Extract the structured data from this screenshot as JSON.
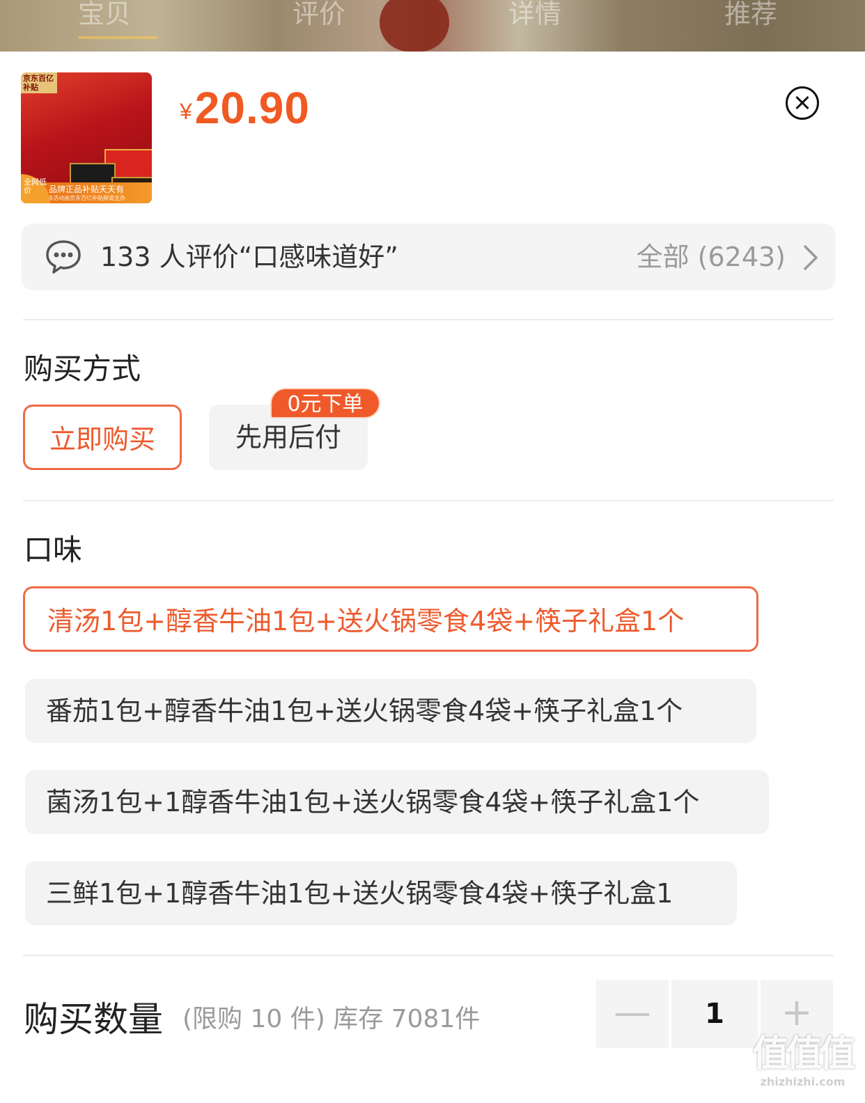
{
  "top_tabs": [
    {
      "label": "宝贝"
    },
    {
      "label": "评价"
    },
    {
      "label": "详情"
    },
    {
      "label": "推荐"
    }
  ],
  "product": {
    "thumb_tag": "京东百亿补贴",
    "thumb_caption": "品牌正品补贴天天有",
    "thumb_caption_sub": "该活动由京东百亿补贴频道主办",
    "thumb_corner": "全网低价",
    "price_symbol": "¥",
    "price": "20.90"
  },
  "review": {
    "summary": "133 人评价“口感味道好”",
    "all_label": "全部 (6243)"
  },
  "purchase_method": {
    "title": "购买方式",
    "options": [
      {
        "label": "立即购买",
        "selected": true
      },
      {
        "label": "先用后付",
        "selected": false,
        "badge": "0元下单"
      }
    ]
  },
  "flavor": {
    "title": "口味",
    "options": [
      {
        "label": "清汤1包+醇香牛油1包+送火锅零食4袋+筷子礼盒1个",
        "selected": true
      },
      {
        "label": "番茄1包+醇香牛油1包+送火锅零食4袋+筷子礼盒1个",
        "selected": false
      },
      {
        "label": "菌汤1包+1醇香牛油1包+送火锅零食4袋+筷子礼盒1个",
        "selected": false
      },
      {
        "label": "三鲜1包+1醇香牛油1包+送火锅零食4袋+筷子礼盒1",
        "selected": false
      }
    ]
  },
  "quantity": {
    "title": "购买数量",
    "hint": "(限购 10 件) 库存 7081件",
    "minus": "—",
    "value": "1",
    "plus": "+"
  },
  "watermark": {
    "main": "值值值",
    "sub": "zhizhizhi.com"
  },
  "colors": {
    "accent": "#ee5a2c",
    "badge": "#f05a2a"
  }
}
